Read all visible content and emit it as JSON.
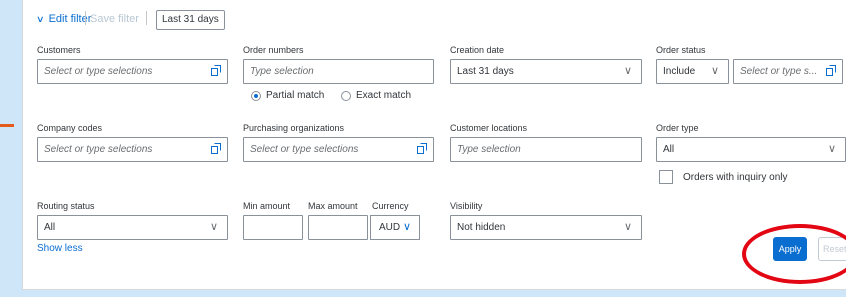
{
  "header": {
    "edit_filter": "Edit filter",
    "save_filter": "Save filter",
    "period_token": "Last 31 days"
  },
  "row1": {
    "customers": {
      "label": "Customers",
      "placeholder": "Select or type selections"
    },
    "order_numbers": {
      "label": "Order numbers",
      "placeholder": "Type selection",
      "match_options": [
        {
          "label": "Partial match",
          "selected": true
        },
        {
          "label": "Exact match",
          "selected": false
        }
      ]
    },
    "creation_date": {
      "label": "Creation date",
      "value": "Last 31 days"
    },
    "order_status": {
      "label": "Order status",
      "operator": "Include",
      "placeholder": "Select or type s..."
    }
  },
  "row2": {
    "company_codes": {
      "label": "Company codes",
      "placeholder": "Select or type selections"
    },
    "purchasing_orgs": {
      "label": "Purchasing organizations",
      "placeholder": "Select or type selections"
    },
    "customer_locations": {
      "label": "Customer locations",
      "placeholder": "Type selection"
    },
    "order_type": {
      "label": "Order type",
      "value": "All",
      "inquiry_checkbox_label": "Orders with inquiry only"
    }
  },
  "row3": {
    "routing_status": {
      "label": "Routing status",
      "value": "All"
    },
    "min_amount": {
      "label": "Min amount",
      "value": ""
    },
    "max_amount": {
      "label": "Max amount",
      "value": ""
    },
    "currency": {
      "label": "Currency",
      "value": "AUD"
    },
    "visibility": {
      "label": "Visibility",
      "value": "Not hidden"
    }
  },
  "footer": {
    "show_less": "Show less",
    "apply": "Apply",
    "reset": "Reset"
  },
  "colors": {
    "accent": "#0a6ed1",
    "annotation_red": "#e30613",
    "background": "#cfe6f8"
  }
}
